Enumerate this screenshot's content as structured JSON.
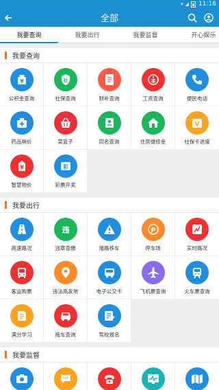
{
  "status": {
    "time": "11:16"
  },
  "header": {
    "title": "全部"
  },
  "tabs": [
    "我要查询",
    "我要出行",
    "我要监督",
    "开心娱乐"
  ],
  "sections": [
    {
      "title": "我要查询",
      "items": [
        {
          "label": "公积金查询",
          "icon": "yuan-bag-icon",
          "color": "#1e8fe0",
          "glyph": "¥"
        },
        {
          "label": "社保查询",
          "icon": "social-security-icon",
          "color": "#19b65a",
          "glyph": "社"
        },
        {
          "label": "财补查询",
          "icon": "document-icon",
          "color": "#ff5a4b",
          "glyph": ""
        },
        {
          "label": "工资查询",
          "icon": "wage-icon",
          "color": "#f23030",
          "glyph": ""
        },
        {
          "label": "便民电话",
          "icon": "phone-icon",
          "color": "#1e8fe0",
          "glyph": ""
        },
        {
          "label": "药品哨价",
          "icon": "medicine-icon",
          "color": "#1e8fe0",
          "glyph": ""
        },
        {
          "label": "菜篮子",
          "icon": "basket-icon",
          "color": "#e8323a",
          "glyph": ""
        },
        {
          "label": "同名查询",
          "icon": "id-card-icon",
          "color": "#19b65a",
          "glyph": ""
        },
        {
          "label": "住房维修金",
          "icon": "house-icon",
          "color": "#19b65a",
          "glyph": ""
        },
        {
          "label": "社保卡进度",
          "icon": "card-progress-icon",
          "color": "#ffa21f",
          "glyph": "V"
        },
        {
          "label": "智慧物价",
          "icon": "price-icon",
          "color": "#f23030",
          "glyph": "¥"
        },
        {
          "label": "彩票开奖",
          "icon": "lottery-icon",
          "color": "#1e8fe0",
          "glyph": "彩"
        }
      ]
    },
    {
      "title": "我要出行",
      "items": [
        {
          "label": "高速路况",
          "icon": "highway-icon",
          "color": "#1e8fe0",
          "glyph": ""
        },
        {
          "label": "违章查缴",
          "icon": "violation-icon",
          "color": "#19b65a",
          "glyph": "违"
        },
        {
          "label": "堵路移车",
          "icon": "warning-icon",
          "color": "#1e8fe0",
          "glyph": "!"
        },
        {
          "label": "停车场",
          "icon": "parking-icon",
          "color": "#ff8a2a",
          "glyph": "P"
        },
        {
          "label": "实时路况",
          "icon": "road-map-icon",
          "color": "#f23030",
          "glyph": ""
        },
        {
          "label": "客运购票",
          "icon": "bus-front-icon",
          "color": "#f23030",
          "glyph": ""
        },
        {
          "label": "违法高发地",
          "icon": "location-icon",
          "color": "#ff8a2a",
          "glyph": ""
        },
        {
          "label": "电子公交卡",
          "icon": "bus-card-icon",
          "color": "#1e8fe0",
          "glyph": ""
        },
        {
          "label": "飞机票查询",
          "icon": "plane-icon",
          "color": "#8a6cf0",
          "glyph": ""
        },
        {
          "label": "火车票查询",
          "icon": "train-icon",
          "color": "#1e8fe0",
          "glyph": ""
        },
        {
          "label": "满分学习",
          "icon": "book-icon",
          "color": "#ffa21f",
          "glyph": ""
        },
        {
          "label": "拖车查询",
          "icon": "tow-truck-icon",
          "color": "#f23030",
          "glyph": ""
        },
        {
          "label": "驾校报名",
          "icon": "signup-icon",
          "color": "#1e8fe0",
          "glyph": ""
        }
      ]
    },
    {
      "title": "我要监督",
      "items": [
        {
          "label": "随手拍",
          "icon": "camera-icon",
          "color": "#1e8fe0",
          "glyph": ""
        },
        {
          "label": "市民论坛",
          "icon": "forum-icon",
          "color": "#ffa21f",
          "glyph": ""
        },
        {
          "label": "市长热线",
          "icon": "hotline-icon",
          "color": "#f23030",
          "glyph": ""
        },
        {
          "label": "环保监测",
          "icon": "monitor-icon",
          "color": "#1ab3b8",
          "glyph": ""
        },
        {
          "label": "老赖地图",
          "icon": "map-icon",
          "color": "#1e8fe0",
          "glyph": ""
        }
      ]
    }
  ]
}
